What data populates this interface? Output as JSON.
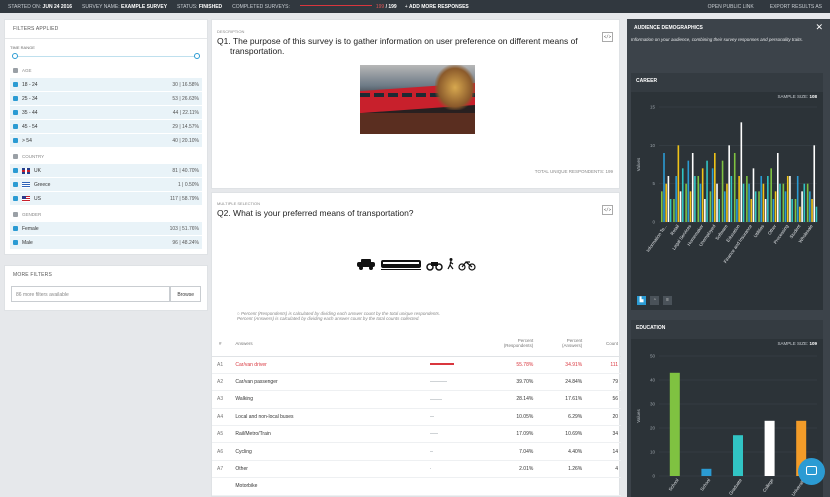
{
  "topbar": {
    "started_label": "STARTED ON:",
    "started_value": "JUN 24 2016",
    "survey_label": "SURVEY NAME:",
    "survey_value": "EXAMPLE SURVEY",
    "status_label": "STATUS:",
    "status_value": "FINISHED",
    "completed_label": "COMPLETED SURVEYS:",
    "completed_count": "199",
    "completed_total": "199",
    "add_label": "ADD MORE RESPONSES",
    "open_link": "OPEN PUBLIC LINK",
    "export": "EXPORT RESULTS AS"
  },
  "filters": {
    "title": "FILTERS APPLIED",
    "time_range": "TIME RANGE",
    "groups": [
      {
        "name": "AGE",
        "items": [
          {
            "label": "18 - 24",
            "count": "30",
            "pct": "16.58%"
          },
          {
            "label": "25 - 34",
            "count": "53",
            "pct": "26.63%"
          },
          {
            "label": "35 - 44",
            "count": "44",
            "pct": "22.11%"
          },
          {
            "label": "45 - 54",
            "count": "29",
            "pct": "14.57%"
          },
          {
            "label": "> 54",
            "count": "40",
            "pct": "20.10%"
          }
        ]
      },
      {
        "name": "COUNTRY",
        "items": [
          {
            "label": "UK",
            "count": "81",
            "pct": "40.70%",
            "flag": "uk"
          },
          {
            "label": "Greece",
            "count": "1",
            "pct": "0.50%",
            "flag": "gr"
          },
          {
            "label": "US",
            "count": "117",
            "pct": "58.79%",
            "flag": "us"
          }
        ]
      },
      {
        "name": "GENDER",
        "items": [
          {
            "label": "Female",
            "count": "103",
            "pct": "51.76%"
          },
          {
            "label": "Male",
            "count": "96",
            "pct": "48.24%"
          }
        ]
      }
    ]
  },
  "more_filters": {
    "title": "MORE FILTERS",
    "placeholder": "86 more filters available",
    "browse": "Browse"
  },
  "q1": {
    "type": "DESCRIPTION",
    "title_line1": "Q1. The purpose of this survey is to gather information on user preference on different means of",
    "title_line2": "transportation.",
    "code": "</>",
    "total_label": "TOTAL UNIQUE RESPONDENTS:",
    "total_value": "199"
  },
  "q2": {
    "type": "MULTIPLE SELECTION",
    "title": "Q2. What is your preferred means of transportation?",
    "code": "</>",
    "note1": "Percent (Respondents) is calculated by dividing each answer count by the total unique respondents.",
    "note2": "Percent (Answers) is calculated by dividing each answer count by the total counts collected.",
    "headers": {
      "num": "#",
      "answers": "Answers",
      "pr": "Percent\n(Respondents)",
      "pa": "Percent\n(Answers)",
      "count": "Count"
    },
    "rows": [
      {
        "id": "A1",
        "label": "Car/van driver",
        "pr": "55.78%",
        "pa": "34.91%",
        "count": "111"
      },
      {
        "id": "A2",
        "label": "Car/van passenger",
        "pr": "39.70%",
        "pa": "24.84%",
        "count": "79"
      },
      {
        "id": "A3",
        "label": "Walking",
        "pr": "28.14%",
        "pa": "17.61%",
        "count": "56"
      },
      {
        "id": "A4",
        "label": "Local and non-local buses",
        "pr": "10.05%",
        "pa": "6.29%",
        "count": "20"
      },
      {
        "id": "A5",
        "label": "Rail/Metro/Train",
        "pr": "17.09%",
        "pa": "10.69%",
        "count": "34"
      },
      {
        "id": "A6",
        "label": "Cycling",
        "pr": "7.04%",
        "pa": "4.40%",
        "count": "14"
      },
      {
        "id": "A7",
        "label": "Other",
        "pr": "2.01%",
        "pa": "1.26%",
        "count": "4"
      },
      {
        "id": "",
        "label": "Motorbike",
        "pr": "",
        "pa": "",
        "count": ""
      }
    ]
  },
  "demographics": {
    "title": "AUDIENCE DEMOGRAPHICS",
    "intro": "Information on your audience, combining their survey responses and personality traits.",
    "career": {
      "title": "CAREER",
      "sample_label": "SAMPLE SIZE:",
      "sample_value": "108"
    },
    "education": {
      "title": "EDUCATION",
      "sample_label": "SAMPLE SIZE:",
      "sample_value": "109"
    }
  },
  "chart_data": [
    {
      "type": "bar",
      "title": "CAREER",
      "ylabel": "Values",
      "ylim": [
        0,
        15
      ],
      "yticks": [
        0,
        5,
        10,
        15
      ],
      "categories": [
        "Information Te...",
        "Retail",
        "Legal Services",
        "Homemaker",
        "Unemployed",
        "Software",
        "Education",
        "Finance and Insurance",
        "Utilities",
        "Other",
        "Processing",
        "Student",
        "Wholesale"
      ],
      "series": [
        {
          "color": "#7fc241",
          "values": [
            4,
            3,
            5,
            6,
            4,
            8,
            9,
            6,
            4,
            7,
            5,
            3,
            5
          ]
        },
        {
          "color": "#2b9bd3",
          "values": [
            9,
            6,
            8,
            5,
            7,
            4,
            3,
            5,
            6,
            3,
            4,
            6,
            4
          ]
        },
        {
          "color": "#f0c419",
          "values": [
            5,
            10,
            4,
            7,
            9,
            5,
            6,
            3,
            5,
            4,
            6,
            2,
            3
          ]
        },
        {
          "color": "#ffffff",
          "values": [
            6,
            4,
            9,
            3,
            5,
            10,
            13,
            7,
            3,
            9,
            6,
            4,
            10
          ]
        },
        {
          "color": "#31c4c4",
          "values": [
            3,
            7,
            6,
            8,
            3,
            6,
            5,
            4,
            6,
            5,
            3,
            5,
            2
          ]
        }
      ]
    },
    {
      "type": "bar",
      "title": "EDUCATION",
      "ylabel": "Values",
      "ylim": [
        0,
        50
      ],
      "yticks": [
        0,
        10,
        20,
        30,
        40,
        50
      ],
      "categories": [
        "School",
        "School",
        "Graduate",
        "College",
        "University"
      ],
      "values": [
        43,
        3,
        17,
        23,
        23
      ],
      "colors": [
        "#7fc241",
        "#2b9bd3",
        "#31c4c4",
        "#ffffff",
        "#f39c29"
      ]
    }
  ]
}
